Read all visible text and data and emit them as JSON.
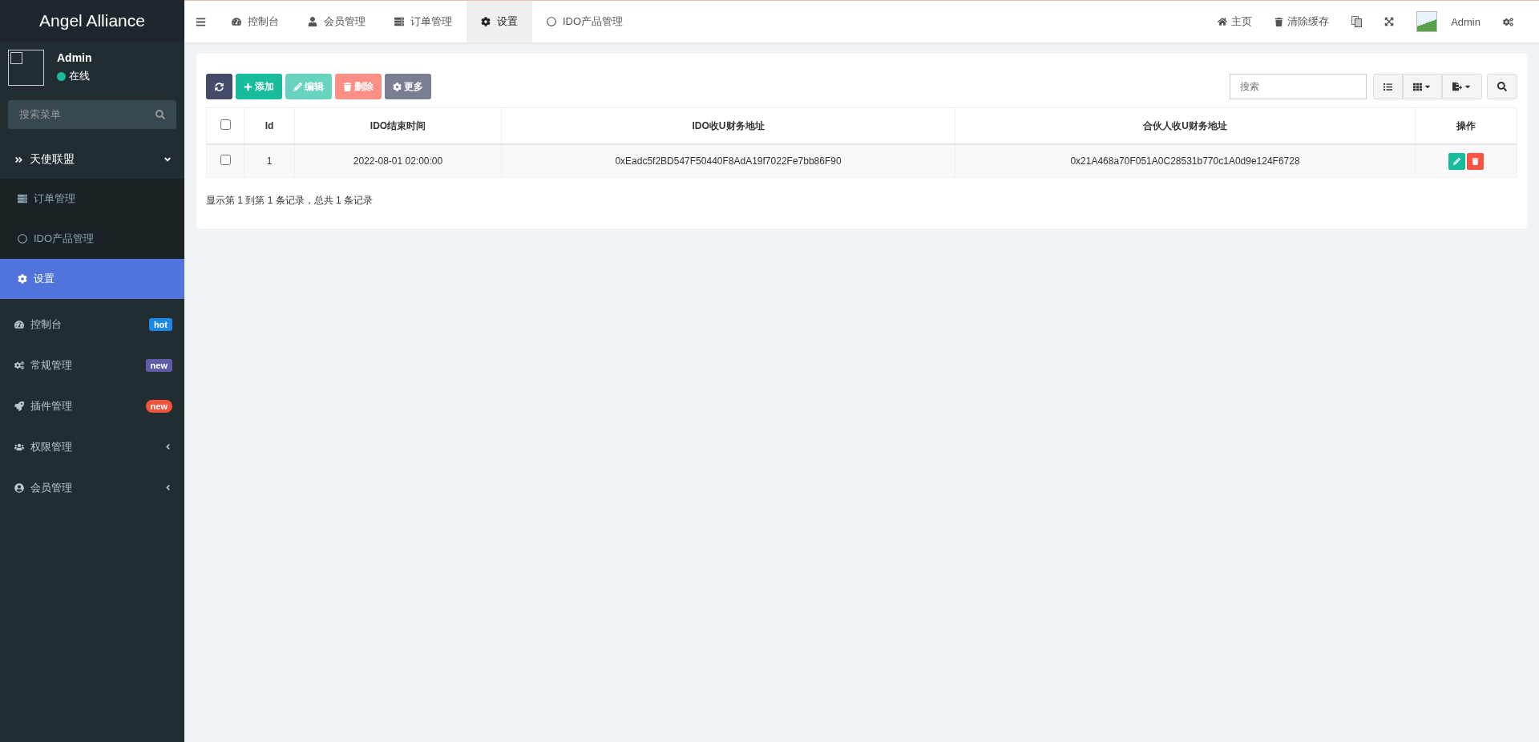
{
  "logo": "Angel Alliance",
  "user": {
    "name": "Admin",
    "status": "在线"
  },
  "menu_search": {
    "placeholder": "搜索菜单"
  },
  "sidebar": {
    "group": {
      "label": "天使联盟",
      "expanded": true,
      "children": [
        {
          "label": "订单管理",
          "selected": false
        },
        {
          "label": "IDO产品管理",
          "selected": false
        },
        {
          "label": "设置",
          "selected": true
        }
      ]
    },
    "items": [
      {
        "label": "控制台",
        "badge": "hot",
        "color": "#1e88e5",
        "kind": "badge"
      },
      {
        "label": "常规管理",
        "badge": "new",
        "color": "#605ca8",
        "kind": "badge"
      },
      {
        "label": "插件管理",
        "badge": "new",
        "color": "#f4543c",
        "kind": "pill"
      },
      {
        "label": "权限管理",
        "kind": "submenu",
        "expanded": false
      },
      {
        "label": "会员管理",
        "kind": "submenu",
        "expanded": false
      }
    ]
  },
  "tabs": [
    {
      "label": "控制台",
      "selected": false
    },
    {
      "label": "会员管理",
      "selected": false
    },
    {
      "label": "订单管理",
      "selected": false
    },
    {
      "label": "设置",
      "selected": true
    },
    {
      "label": "IDO产品管理",
      "selected": false
    }
  ],
  "header_right": {
    "home": "主页",
    "clear_cache": "清除缓存",
    "user": "Admin"
  },
  "toolbar": {
    "buttons": [
      {
        "kind": "refresh",
        "disabled": false
      },
      {
        "kind": "add",
        "label": "添加",
        "disabled": false
      },
      {
        "kind": "edit",
        "label": "编辑",
        "disabled": true
      },
      {
        "kind": "delete",
        "label": "删除",
        "disabled": true
      },
      {
        "kind": "more",
        "label": "更多",
        "disabled": false
      }
    ],
    "search": {
      "placeholder": "搜索"
    }
  },
  "table": {
    "all_checked": false,
    "columns": [
      "Id",
      "IDO结束时间",
      "IDO收U财务地址",
      "合伙人收U财务地址",
      "操作"
    ],
    "rows": [
      {
        "checked": false,
        "cells": [
          "1",
          "2022-08-01 02:00:00",
          "0xEadc5f2BD547F50440F8AdA19f7022Fe7bb86F90",
          "0x21A468a70F051A0C28531b770c1A0d9e124F6728"
        ]
      }
    ]
  },
  "pagination": "显示第 1 到第 1 条记录，总共 1 条记录"
}
